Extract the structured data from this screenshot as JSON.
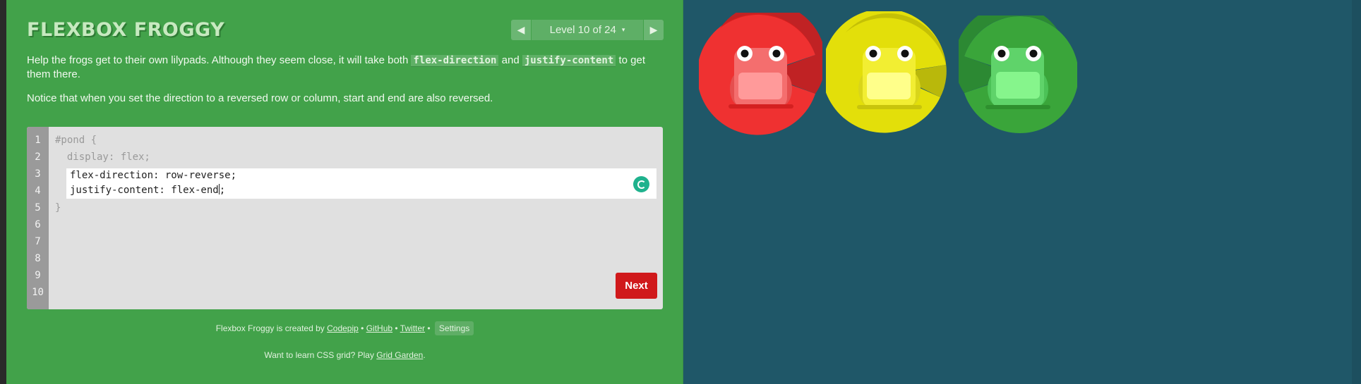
{
  "app": {
    "title": "FLEXBOX FROGGY"
  },
  "level_nav": {
    "prev_icon": "triangle-left-icon",
    "level_label": "Level 10 of 24",
    "caret_glyph": "▾",
    "next_icon": "triangle-right-icon"
  },
  "instructions": {
    "p1_before": "Help the frogs get to their own lilypads. Although they seem close, it will take both ",
    "code1": "flex-direction",
    "p1_and": " and ",
    "code2": "justify-content",
    "p1_after": " to get them there.",
    "p2": "Notice that when you set the direction to a reversed row or column, start and end are also reversed."
  },
  "editor": {
    "line_numbers": [
      "1",
      "2",
      "3",
      "4",
      "5",
      "6",
      "7",
      "8",
      "9",
      "10"
    ],
    "line1": "#pond {",
    "line2": "  display: flex;",
    "input_line1": "flex-direction: row-reverse;",
    "input_line2_a": "justify-content: flex-end",
    "input_line2_b": ";",
    "line5": "}",
    "next_label": "Next"
  },
  "footer": {
    "credit_prefix": "Flexbox Froggy is created by ",
    "codepip": "Codepip",
    "sep1": " • ",
    "github": "GitHub",
    "sep2": " • ",
    "twitter": "Twitter",
    "sep3": " • ",
    "settings": "Settings",
    "grid_prefix": "Want to learn CSS grid? Play ",
    "grid_link": "Grid Garden",
    "grid_suffix": "."
  },
  "pond": {
    "frogs": [
      {
        "color": "red",
        "body": "#f46e6e",
        "pad": "#d42020"
      },
      {
        "color": "yellow",
        "body": "#f2ee32",
        "pad": "#c8c40c"
      },
      {
        "color": "green",
        "body": "#5fd36a",
        "pad": "#2e8f2e"
      }
    ]
  },
  "colors": {
    "sidebar": "#42a24a",
    "pond": "#1f5768",
    "next_button": "#d0191b"
  }
}
